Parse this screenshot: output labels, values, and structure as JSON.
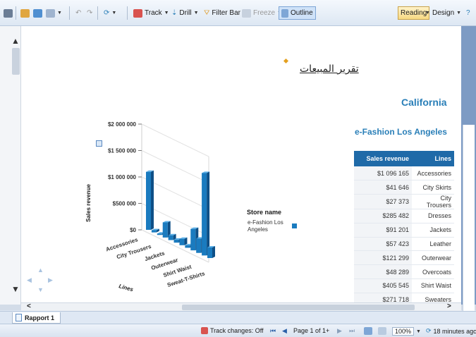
{
  "toolbar": {
    "track_label": "Track",
    "drill_label": "Drill",
    "filter_bar_label": "Filter Bar",
    "freeze_label": "Freeze",
    "outline_label": "Outline",
    "reading_label": "Reading",
    "design_label": "Design"
  },
  "report": {
    "title": "تقرير المبيعات",
    "section_title": "California",
    "store_title": "e-Fashion Los Angeles"
  },
  "table": {
    "headers": [
      "Sales revenue",
      "Lines"
    ],
    "rows": [
      [
        "$1 096 165",
        "Accessories"
      ],
      [
        "$41 646",
        "City Skirts"
      ],
      [
        "$27 373",
        "City Trousers"
      ],
      [
        "$285 482",
        "Dresses"
      ],
      [
        "$91 201",
        "Jackets"
      ],
      [
        "$57 423",
        "Leather"
      ],
      [
        "$121 299",
        "Outerwear"
      ],
      [
        "$48 289",
        "Overcoats"
      ],
      [
        "$405 545",
        "Shirt Waist"
      ],
      [
        "$271 718",
        "Sweaters"
      ]
    ]
  },
  "chart_data": {
    "type": "bar",
    "ylabel": "Sales revenue",
    "xlabel": "Lines",
    "ylim": [
      0,
      2000000
    ],
    "yticks": [
      "$2 000 000",
      "$1 500 000",
      "$1 000 000",
      "$500 000",
      "$0"
    ],
    "category_labels": [
      "Accessories",
      "City Trousers",
      "Jackets",
      "Outerwear",
      "Shirt Waist",
      "Sweat-T-Shirts"
    ],
    "series": [
      {
        "name": "e-Fashion Los Angeles",
        "values": [
          1096165,
          41646,
          27373,
          285482,
          91201,
          57423,
          121299,
          48289,
          405545,
          271718,
          1560000,
          200000
        ]
      }
    ],
    "legend_title": "Store name",
    "legend_position": "right",
    "color": "#1a7bbf"
  },
  "tabs": [
    {
      "label": "Rapport 1"
    }
  ],
  "status": {
    "track_changes": "Track changes: Off",
    "page": "Page 1 of 1+",
    "zoom": "100%",
    "refreshed": "18 minutes ago"
  }
}
